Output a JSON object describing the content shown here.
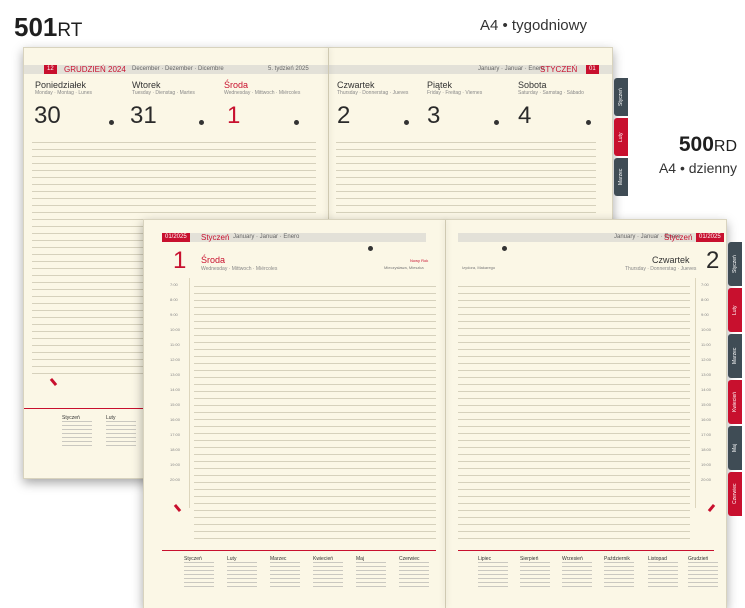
{
  "labels": {
    "weekly": {
      "number": "501",
      "suffix": "RT",
      "subtitle": "A4 • tygodniowy"
    },
    "daily": {
      "number": "500",
      "suffix": "RD",
      "subtitle": "A4 • dzienny"
    }
  },
  "weekly_planner": {
    "header_left": {
      "month_num": "12",
      "month_name": "GRUDZIEŃ 2024",
      "month_translations": "December · Dezember · Dicembre",
      "week_info": "5. tydzień 2025"
    },
    "header_right": {
      "month_translations": "January · Januar · Enero",
      "month_name": "STYCZEŃ",
      "month_num": "01"
    },
    "days": [
      {
        "name": "Poniedziałek",
        "sub": "Monday · Montag · Lunes",
        "num": "30",
        "red": false
      },
      {
        "name": "Wtorek",
        "sub": "Tuesday · Dienstag · Martes",
        "num": "31",
        "red": false
      },
      {
        "name": "Środa",
        "sub": "Wednesday · Mittwoch · Miércoles",
        "num": "1",
        "red": true
      },
      {
        "name": "Czwartek",
        "sub": "Thursday · Donnerstag · Jueves",
        "num": "2",
        "red": false
      },
      {
        "name": "Piątek",
        "sub": "Friday · Freitag · Viernes",
        "num": "3",
        "red": false
      },
      {
        "name": "Sobota",
        "sub": "Saturday · Samstag · Sábado",
        "num": "4",
        "red": false
      }
    ],
    "mini_months": [
      "Styczeń",
      "Luty"
    ]
  },
  "daily_planner": {
    "left": {
      "month_chip": "01/2025",
      "month_name": "Styczeń",
      "month_translations": "January · Januar · Enero",
      "day_num": "1",
      "day_name": "Środa",
      "day_sub": "Wednesday · Mittwoch · Miércoles",
      "note_red": "Nowy Rok",
      "note": "Mieczysława, Mieszka"
    },
    "right": {
      "month_translations": "January · Januar · Enero",
      "month_name": "Styczeń",
      "month_chip": "01/2025",
      "day_num": "2",
      "day_name": "Czwartek",
      "day_sub": "Thursday · Donnerstag · Jueves",
      "note": "Izydora, Makarego"
    },
    "hours": [
      "7:00",
      "8:00",
      "9:00",
      "10:00",
      "11:00",
      "12:00",
      "13:00",
      "14:00",
      "15:00",
      "16:00",
      "17:00",
      "18:00",
      "19:00",
      "20:00"
    ],
    "mini_months_left": [
      "Styczeń",
      "Luty",
      "Marzec",
      "Kwiecień",
      "Maj",
      "Czerwiec"
    ],
    "mini_months_right": [
      "Lipiec",
      "Sierpień",
      "Wrzesień",
      "Październik",
      "Listopad",
      "Grudzień"
    ]
  },
  "tabs": [
    "Styczeń",
    "Luty",
    "Marzec",
    "Kwiecień",
    "Maj",
    "Czerwiec"
  ]
}
